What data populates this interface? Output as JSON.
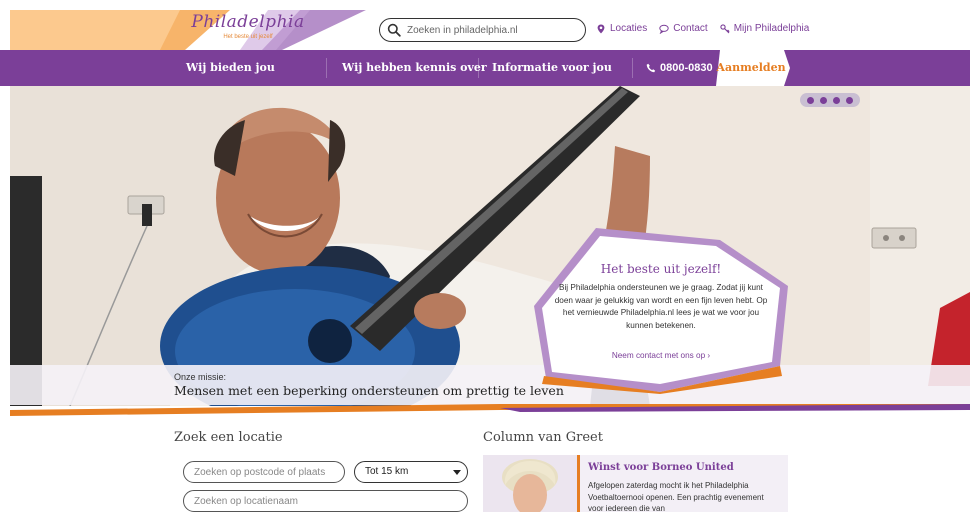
{
  "brand": {
    "name": "Philadelphia",
    "tagline": "Het beste uit jezelf",
    "purple": "#7b3f98",
    "orange": "#e67e22",
    "peach": "#fcc98e"
  },
  "header": {
    "search_placeholder": "Zoeken in philadelphia.nl",
    "links": [
      {
        "label": "Locaties",
        "icon": "location-pin-icon"
      },
      {
        "label": "Contact",
        "icon": "chat-bubble-icon"
      },
      {
        "label": "Mijn Philadelphia",
        "icon": "key-icon"
      }
    ]
  },
  "nav": {
    "items": [
      "Wij bieden jou",
      "Wij hebben kennis over",
      "Informatie voor jou"
    ],
    "phone": "0800-0830",
    "login": "Aanmelden"
  },
  "hero": {
    "tools": [
      "audio-icon",
      "zoom-icon",
      "eye-icon",
      "print-icon"
    ],
    "mission_label": "Onze missie:",
    "mission_text": "Mensen met een beperking ondersteunen om prettig te leven",
    "bubble": {
      "title": "Het beste uit jezelf!",
      "body": "Bij Philadelphia ondersteunen we je graag. Zodat jij kunt doen waar je gelukkig van wordt en een fijn leven hebt. Op het vernieuwde Philadelphia.nl lees je wat we voor jou kunnen betekenen.",
      "link": "Neem contact met ons op ›"
    }
  },
  "location": {
    "title": "Zoek een locatie",
    "postcode_placeholder": "Zoeken op postcode of plaats",
    "radius_selected": "Tot 15 km",
    "name_placeholder": "Zoeken op locatienaam"
  },
  "column": {
    "title": "Column van Greet",
    "card_title": "Winst voor Borneo United",
    "card_text": "Afgelopen zaterdag mocht ik het Philadelphia Voetbaltoernooi openen. Een prachtig evenement voor iedereen die van"
  }
}
